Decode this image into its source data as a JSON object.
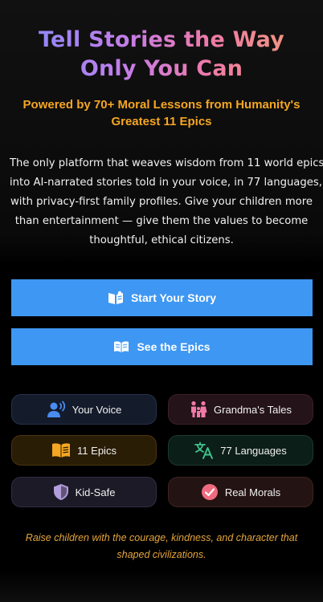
{
  "hero": {
    "title_line1": "Tell Stories the Way",
    "title_line2": "Only You Can",
    "subtitle_line1": "Powered by 70+ Moral Lessons from Humanity's",
    "subtitle_line2": "Greatest 11 Epics",
    "description_lines": [
      "The only platform that weaves wisdom from 11 world epics",
      "into AI-narrated stories told in your voice, in 77 languages,",
      "with privacy-first family profiles. Give your children more",
      "than entertainment — give them the values to become",
      "thoughtful, ethical citizens."
    ]
  },
  "buttons": {
    "start_label": "Start Your Story",
    "start_icon": "open-book-reader-icon",
    "epics_label": "See the Epics",
    "epics_icon": "open-book-icon",
    "color": "#3e97f2"
  },
  "features": [
    {
      "label": "Your Voice",
      "icon": "voice-speaker-icon",
      "color": "#4a8cf0"
    },
    {
      "label": "Grandma's Tales",
      "icon": "family-icon",
      "color": "#f07aa8"
    },
    {
      "label": "11 Epics",
      "icon": "book-icon",
      "color": "#f5a623"
    },
    {
      "label": "77 Languages",
      "icon": "translate-icon",
      "color": "#3fc48e"
    },
    {
      "label": "Kid-Safe",
      "icon": "shield-icon",
      "color": "#b39ddb"
    },
    {
      "label": "Real Morals",
      "icon": "check-circle-icon",
      "color": "#f06b7e"
    }
  ],
  "tagline_lines": [
    "Raise children with the courage, kindness, and character that",
    "shaped civilizations."
  ]
}
